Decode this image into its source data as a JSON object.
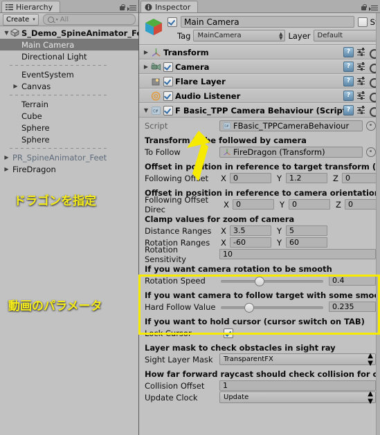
{
  "hierarchy": {
    "tab_label": "Hierarchy",
    "create_label": "Create",
    "create_caret": "▾",
    "search_placeholder": "All",
    "items": [
      {
        "label": "S_Demo_SpineAnimator_Feet",
        "tri": "▼",
        "depth": 0,
        "selected": false,
        "root": true,
        "dim": false
      },
      {
        "label": "Main Camera",
        "tri": "",
        "depth": 1,
        "selected": true,
        "root": false,
        "dim": false
      },
      {
        "label": "Directional Light",
        "tri": "",
        "depth": 1,
        "selected": false,
        "root": false,
        "dim": false
      },
      {
        "label": "__SEP__",
        "tri": "",
        "depth": 1,
        "selected": false,
        "root": false,
        "dim": false
      },
      {
        "label": "EventSystem",
        "tri": "",
        "depth": 1,
        "selected": false,
        "root": false,
        "dim": false
      },
      {
        "label": "Canvas",
        "tri": "▶",
        "depth": 1,
        "selected": false,
        "root": false,
        "dim": false
      },
      {
        "label": "__SEP__",
        "tri": "",
        "depth": 1,
        "selected": false,
        "root": false,
        "dim": false
      },
      {
        "label": "Terrain",
        "tri": "",
        "depth": 1,
        "selected": false,
        "root": false,
        "dim": false
      },
      {
        "label": "Cube",
        "tri": "",
        "depth": 1,
        "selected": false,
        "root": false,
        "dim": false
      },
      {
        "label": "Sphere",
        "tri": "",
        "depth": 1,
        "selected": false,
        "root": false,
        "dim": false
      },
      {
        "label": "Sphere",
        "tri": "",
        "depth": 1,
        "selected": false,
        "root": false,
        "dim": false
      },
      {
        "label": "__SEP__",
        "tri": "",
        "depth": 1,
        "selected": false,
        "root": false,
        "dim": false
      },
      {
        "label": "PR_SpineAnimator_Feet",
        "tri": "▶",
        "depth": 0,
        "selected": false,
        "root": false,
        "dim": true
      },
      {
        "label": "FireDragon",
        "tri": "▶",
        "depth": 0,
        "selected": false,
        "root": false,
        "dim": false
      }
    ]
  },
  "inspector": {
    "tab_label": "Inspector",
    "object_name": "Main Camera",
    "object_enabled": true,
    "static_label": "Static",
    "static_checked": false,
    "static_caret": "▾",
    "tag_label": "Tag",
    "tag_value": "MainCamera",
    "layer_label": "Layer",
    "layer_value": "Default",
    "components": [
      {
        "name": "Transform",
        "tri": "▶",
        "checkbox": false,
        "checked": false,
        "icon": "transform-icon"
      },
      {
        "name": "Camera",
        "tri": "▶",
        "checkbox": true,
        "checked": true,
        "icon": "camera-icon"
      },
      {
        "name": "Flare Layer",
        "tri": "",
        "checkbox": true,
        "checked": true,
        "icon": "flare-layer-icon"
      },
      {
        "name": "Audio Listener",
        "tri": "",
        "checkbox": true,
        "checked": true,
        "icon": "audio-listener-icon"
      },
      {
        "name": "F Basic_TPP Camera Behaviour (Script)",
        "tri": "▼",
        "checkbox": true,
        "checked": true,
        "icon": "script-icon"
      }
    ],
    "script": {
      "script_label": "Script",
      "script_value": "FBasic_TPPCameraBehaviour",
      "sections": [
        {
          "header": "Transform to be followed by camera",
          "rows": [
            {
              "type": "object",
              "label": "To Follow",
              "value": "FireDragon (Transform)"
            }
          ]
        },
        {
          "header": "Offset in position in reference to target transform (focus",
          "rows": [
            {
              "type": "vector3",
              "label": "Following Offset",
              "x": "0",
              "y": "1.2",
              "z": "0"
            }
          ]
        },
        {
          "header": "Offset in position in reference to camera orientation",
          "rows": [
            {
              "type": "vector3",
              "label": "Following Offset Direc",
              "x": "0",
              "y": "0",
              "z": "0"
            }
          ]
        },
        {
          "header": "Clamp values for zoom of camera",
          "rows": [
            {
              "type": "vector2",
              "label": "Distance Ranges",
              "x": "3.5",
              "y": "5"
            },
            {
              "type": "vector2",
              "label": "Rotation Ranges",
              "x": "-60",
              "y": "60"
            },
            {
              "type": "field",
              "label": "Rotation Sensitivity",
              "value": "10"
            }
          ]
        },
        {
          "header": "If you want camera rotation to be smooth",
          "rows": [
            {
              "type": "slider",
              "label": "Rotation Speed",
              "value": "0.4",
              "percent": 33
            }
          ]
        },
        {
          "header": "If you want camera to follow target with some smoothnes",
          "rows": [
            {
              "type": "slider",
              "label": "Hard Follow Value",
              "value": "0.235",
              "percent": 23
            }
          ]
        },
        {
          "header": "If you want to hold cursor (cursor switch on TAB)",
          "rows": [
            {
              "type": "checkbox",
              "label": "Lock Cursor",
              "checked": true
            }
          ]
        },
        {
          "header": "Layer mask to check obstacles in sight ray",
          "rows": [
            {
              "type": "dropdown",
              "label": "Sight Layer Mask",
              "value": "TransparentFX"
            }
          ]
        },
        {
          "header": "How far forward raycast should check collision for camer",
          "rows": [
            {
              "type": "field",
              "label": "Collision Offset",
              "value": "1"
            },
            {
              "type": "dropdown",
              "label": "Update Clock",
              "value": "Update"
            }
          ]
        }
      ]
    }
  },
  "annotations": {
    "note_dragon": "ドラゴンを指定",
    "note_params": "動画のパラメータ",
    "highlight_color": "#f5ea00",
    "text_color": "#f7ee1a"
  }
}
